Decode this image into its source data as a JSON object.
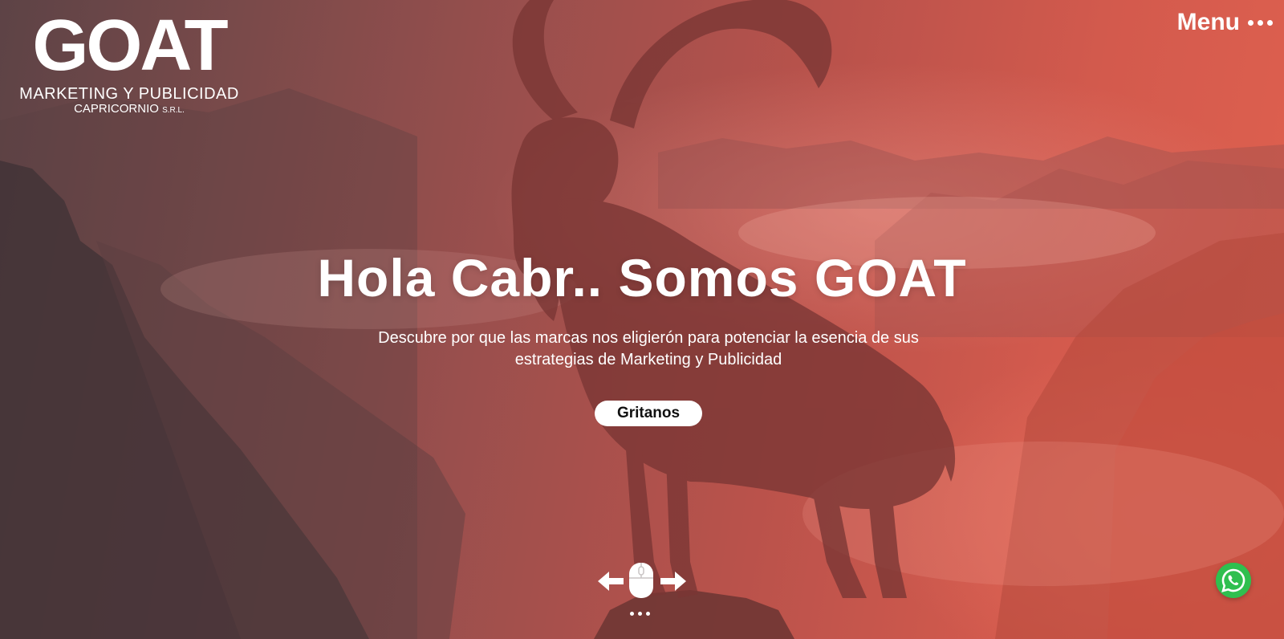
{
  "header": {
    "logo": {
      "wordmark": "GOAT",
      "line1": "MARKETING Y PUBLICIDAD",
      "line2": "CAPRICORNIO",
      "line2_suffix": "S.R.L."
    },
    "menu_label": "Menu"
  },
  "hero": {
    "headline": "Hola Cabr.. Somos GOAT",
    "subheadline": "Descubre por que las marcas nos eligierón para potenciar la esencia de sus estrategias de Marketing y Publicidad",
    "cta_label": "Gritanos"
  },
  "icons": {
    "menu": "more-dots-icon",
    "scroll": "mouse-scroll-icon",
    "prev": "arrow-left-icon",
    "next": "arrow-right-icon",
    "chat": "whatsapp-icon"
  },
  "colors": {
    "overlay_left": "#5d4346",
    "overlay_right": "#e0614f",
    "cta_background": "#ffffff",
    "cta_text": "#111111",
    "whatsapp": "#2fbf4f"
  }
}
